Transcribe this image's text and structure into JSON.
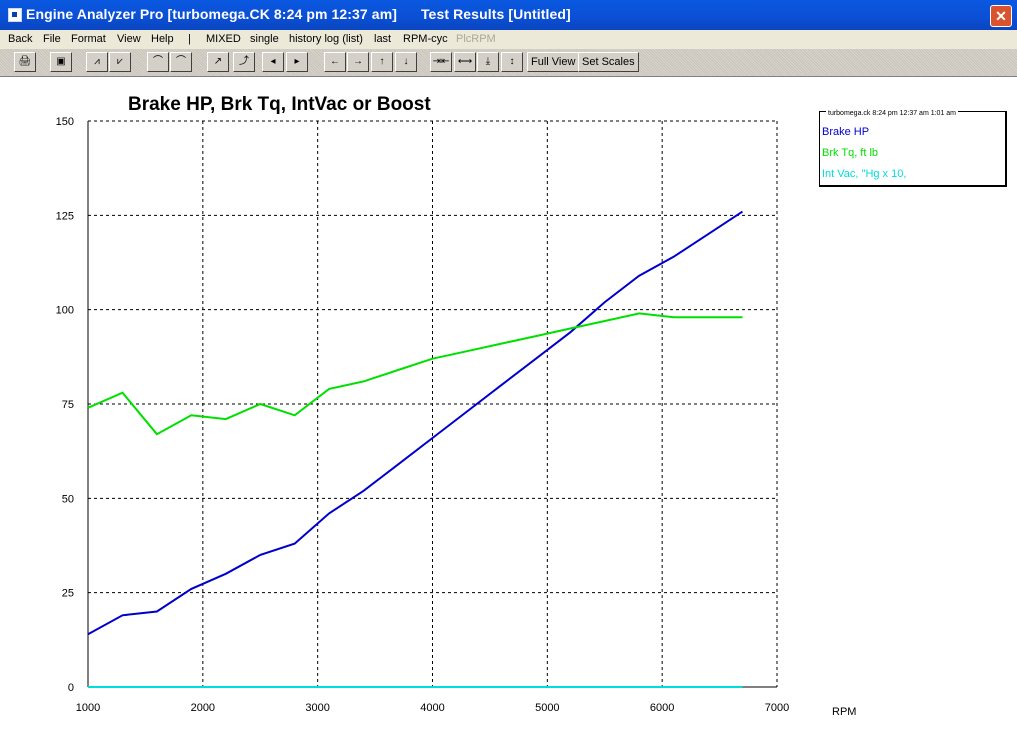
{
  "window": {
    "title": "Engine Analyzer Pro [turbomega.CK 8:24 pm 12:37 am]      Test Results [Untitled]",
    "close_glyph": "✕"
  },
  "menu": [
    "Back",
    "File",
    "Format",
    "View",
    "Help",
    "|",
    "MIXED",
    "single",
    "history log (list)",
    "last",
    "RPM-cyc",
    "PlcRPM"
  ],
  "toolbar": {
    "icons": [
      "print-icon",
      "save-icon",
      "chart-icon",
      "chart-2-icon",
      "curve-icon",
      "curve-2-icon",
      "graph-icon",
      "graph-2-icon",
      "prev-icon",
      "next-icon",
      "arrow-left-icon",
      "arrow-right-icon",
      "arrow-up-icon",
      "arrow-down-icon",
      "shrink-horizontal-icon",
      "expand-horizontal-icon",
      "shrink-vertical-icon",
      "expand-vertical-icon"
    ],
    "glyphs": [
      "🖨",
      "▣",
      "⩘",
      "⩗",
      "⌒",
      "⌒",
      "↗",
      "⤴",
      "◂",
      "▸",
      "←",
      "→",
      "↑",
      "↓",
      "⇥⇤",
      "⟷",
      "⤓",
      "↕"
    ],
    "full_view": "Full View",
    "set_scales": "Set Scales"
  },
  "chart_data": {
    "type": "line",
    "title": "Brake HP, Brk Tq, IntVac or Boost",
    "xlabel": "RPM",
    "ylabel": "",
    "xlim": [
      1000,
      7000
    ],
    "ylim": [
      0,
      150
    ],
    "xticks": [
      1000,
      2000,
      3000,
      4000,
      5000,
      6000,
      7000
    ],
    "yticks": [
      0,
      25,
      50,
      75,
      100,
      125,
      150
    ],
    "grid": true,
    "legend_position": "top-right",
    "legend_header": "turbomega.ck 8:24 pm 12:37 am 1:01 am",
    "series": [
      {
        "name": "Brake HP",
        "color": "#0000cc",
        "x": [
          1000,
          1300,
          1600,
          1900,
          2200,
          2500,
          2800,
          3100,
          3400,
          3700,
          4000,
          4300,
          4600,
          4900,
          5200,
          5500,
          5800,
          6100,
          6400,
          6700
        ],
        "y": [
          14,
          19,
          20,
          26,
          30,
          35,
          38,
          46,
          52,
          59,
          66,
          73,
          80,
          87,
          94,
          102,
          109,
          114,
          120,
          126
        ]
      },
      {
        "name": "Brk Tq, ft lb",
        "color": "#00e000",
        "x": [
          1000,
          1300,
          1600,
          1900,
          2200,
          2500,
          2800,
          3100,
          3400,
          3700,
          4000,
          4300,
          4600,
          4900,
          5200,
          5500,
          5800,
          6100,
          6400,
          6700
        ],
        "y": [
          74,
          78,
          67,
          72,
          71,
          75,
          72,
          79,
          81,
          84,
          87,
          89,
          91,
          93,
          95,
          97,
          99,
          98,
          98,
          98
        ]
      },
      {
        "name": "Int Vac, \"Hg x 10,",
        "color": "#00dddd",
        "x": [
          1000,
          6700
        ],
        "y": [
          0,
          0
        ]
      }
    ]
  }
}
